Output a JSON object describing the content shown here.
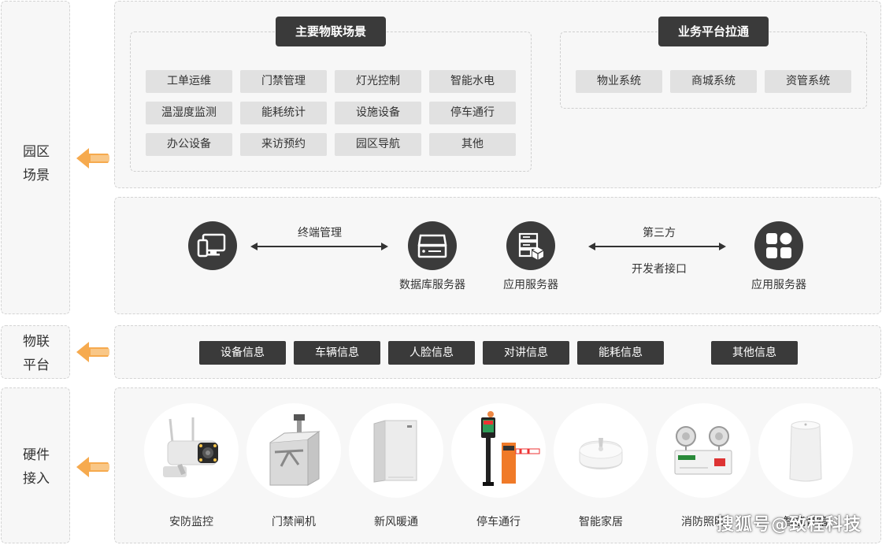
{
  "sidebar": {
    "scene": [
      "园区",
      "场景"
    ],
    "iot": [
      "物联",
      "平台"
    ],
    "hardware": [
      "硬件",
      "接入"
    ]
  },
  "iot_scenes": {
    "title": "主要物联场景",
    "items": [
      "工单运维",
      "门禁管理",
      "灯光控制",
      "智能水电",
      "温湿度监测",
      "能耗统计",
      "设施设备",
      "停车通行",
      "办公设备",
      "来访预约",
      "园区导航",
      "其他"
    ]
  },
  "business": {
    "title": "业务平台拉通",
    "items": [
      "物业系统",
      "商城系统",
      "资管系统"
    ]
  },
  "platform": {
    "conn1": "终端管理",
    "conn2_top": "第三方",
    "conn2_bottom": "开发者接口",
    "nodes": [
      "数据库服务器",
      "应用服务器",
      "应用服务器"
    ]
  },
  "info": [
    "设备信息",
    "车辆信息",
    "人脸信息",
    "对讲信息",
    "能耗信息",
    "其他信息"
  ],
  "devices": [
    "安防监控",
    "门禁闸机",
    "新风暖通",
    "停车通行",
    "智能家居",
    "消防照明",
    "智能音箱"
  ],
  "watermark": "搜狐号@致程科技",
  "colors": {
    "dark": "#3a3a3a",
    "tag": "#e1e1e1",
    "arrow": "#f5a544",
    "panel": "#f7f7f7"
  }
}
